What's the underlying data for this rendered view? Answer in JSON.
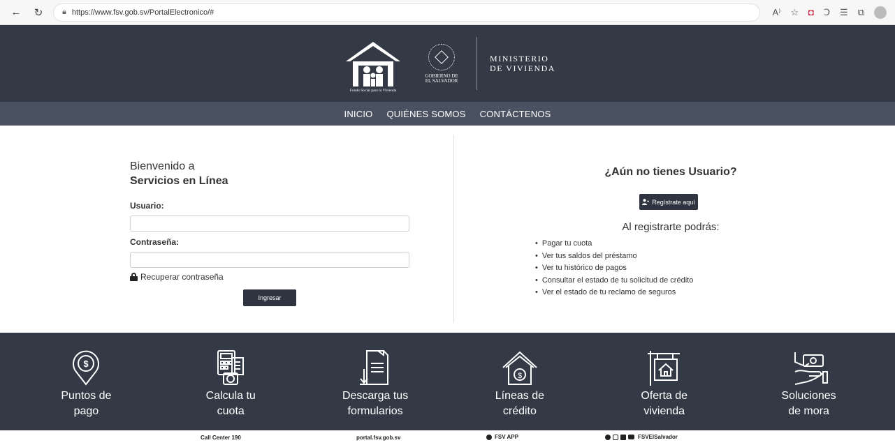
{
  "browser": {
    "url": "https://www.fsv.gob.sv/PortalElectronico/#"
  },
  "header": {
    "fsv_tagline": "Fondo Social para la Vivienda",
    "gob_line1": "GOBIERNO DE",
    "gob_line2": "EL SALVADOR",
    "ministerio_line1": "MINISTERIO",
    "ministerio_line2": "DE VIVIENDA"
  },
  "nav": {
    "items": [
      "INICIO",
      "QUIÉNES SOMOS",
      "CONTÁCTENOS"
    ]
  },
  "login": {
    "welcome": "Bienvenido a",
    "service": "Servicios en Línea",
    "user_label": "Usuario:",
    "user_value": "",
    "password_label": "Contraseña:",
    "password_value": "",
    "recover_label": "Recuperar contraseña",
    "submit_label": "Ingresar"
  },
  "register": {
    "title": "¿Aún no tienes Usuario?",
    "button_label": "Regístrate aquí",
    "benefits_title": "Al registrarte podrás:",
    "benefits": [
      "Pagar tu cuota",
      "Ver tus saldos del préstamo",
      "Ver tu histórico de pagos",
      "Consultar el estado de tu solicitud de crédito",
      "Ver el estado de tu reclamo de seguros"
    ]
  },
  "services": [
    {
      "line1": "Puntos de",
      "line2": "pago",
      "icon": "payment-location-icon"
    },
    {
      "line1": "Calcula tu",
      "line2": "cuota",
      "icon": "calculator-icon"
    },
    {
      "line1": "Descarga tus",
      "line2": "formularios",
      "icon": "download-form-icon"
    },
    {
      "line1": "Líneas de",
      "line2": "crédito",
      "icon": "house-credit-icon"
    },
    {
      "line1": "Oferta de",
      "line2": "vivienda",
      "icon": "housing-offer-icon"
    },
    {
      "line1": "Soluciones",
      "line2": "de mora",
      "icon": "hand-money-icon"
    }
  ],
  "footer": {
    "call_center": "Call Center 190",
    "portal": "portal.fsv.gob.sv",
    "app": "FSV APP",
    "social": "FSVElSalvador"
  },
  "colors": {
    "header_bg": "#333a46",
    "nav_bg": "#4a5262",
    "button_bg": "#2f3540"
  }
}
